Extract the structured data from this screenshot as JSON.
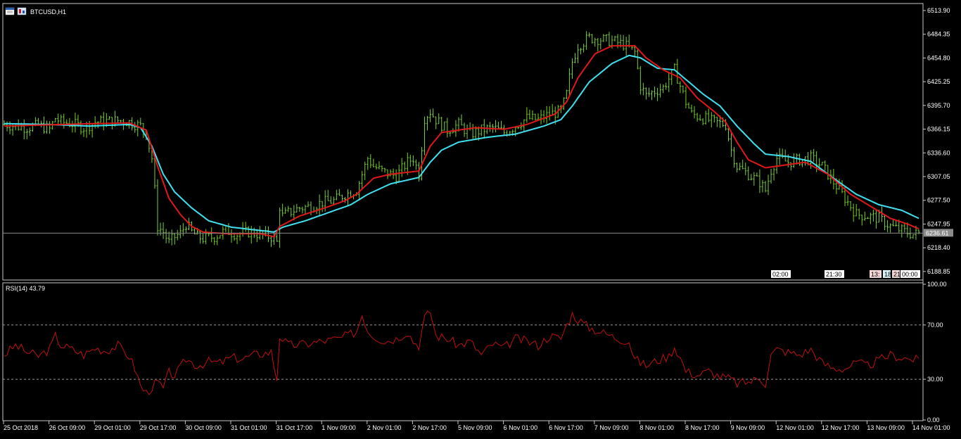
{
  "symbol_label": "BTCUSD,H1",
  "current_price_label": "6236.61",
  "time_tags": [
    "02:00",
    "21:30",
    "13:",
    "18",
    "21",
    "00:00"
  ],
  "indicator_label": "RSI(14) 43.79",
  "colors": {
    "background": "#000000",
    "candle": "#7ad12e",
    "ma_fast": "#e01818",
    "ma_slow": "#3fe0f0",
    "rsi_line": "#c01010",
    "frame": "#c8c8c8",
    "price_line": "#8a8a8a"
  },
  "icons": [
    "window-icon",
    "chart-icon"
  ],
  "chart_data": [
    {
      "type": "candlestick",
      "title": "BTCUSD,H1",
      "ylim": [
        6180,
        6520
      ],
      "y_ticks": [
        "6513.90",
        "6484.35",
        "6454.80",
        "6425.25",
        "6395.70",
        "6366.15",
        "6336.60",
        "6307.05",
        "6277.50",
        "6247.95",
        "6218.40",
        "6188.85"
      ],
      "x_ticks": [
        "25 Oct 2018",
        "26 Oct 09:00",
        "29 Oct 01:00",
        "29 Oct 17:00",
        "30 Oct 09:00",
        "31 Oct 01:00",
        "31 Oct 17:00",
        "1 Nov 09:00",
        "2 Nov 01:00",
        "2 Nov 17:00",
        "5 Nov 09:00",
        "6 Nov 01:00",
        "6 Nov 17:00",
        "7 Nov 09:00",
        "8 Nov 01:00",
        "8 Nov 17:00",
        "9 Nov 09:00",
        "12 Nov 01:00",
        "12 Nov 17:00",
        "13 Nov 09:00",
        "14 Nov 01:00"
      ],
      "current_price": 6236.61,
      "close_path": [
        [
          0,
          6372
        ],
        [
          4,
          6370
        ],
        [
          8,
          6368
        ],
        [
          12,
          6371
        ],
        [
          16,
          6366
        ],
        [
          18,
          6380
        ],
        [
          20,
          6375
        ],
        [
          24,
          6373
        ],
        [
          28,
          6368
        ],
        [
          32,
          6375
        ],
        [
          36,
          6376
        ],
        [
          40,
          6377
        ],
        [
          44,
          6375
        ],
        [
          48,
          6370
        ],
        [
          50,
          6360
        ],
        [
          52,
          6330
        ],
        [
          53,
          6290
        ],
        [
          54,
          6245
        ],
        [
          56,
          6238
        ],
        [
          58,
          6225
        ],
        [
          60,
          6232
        ],
        [
          62,
          6236
        ],
        [
          64,
          6248
        ],
        [
          66,
          6238
        ],
        [
          68,
          6232
        ],
        [
          70,
          6230
        ],
        [
          74,
          6232
        ],
        [
          78,
          6240
        ],
        [
          82,
          6235
        ],
        [
          86,
          6238
        ],
        [
          90,
          6235
        ],
        [
          94,
          6232
        ],
        [
          96,
          6225
        ],
        [
          97,
          6270
        ],
        [
          98,
          6258
        ],
        [
          100,
          6262
        ],
        [
          104,
          6268
        ],
        [
          108,
          6270
        ],
        [
          112,
          6275
        ],
        [
          116,
          6277
        ],
        [
          120,
          6285
        ],
        [
          124,
          6290
        ],
        [
          126,
          6310
        ],
        [
          128,
          6330
        ],
        [
          130,
          6320
        ],
        [
          134,
          6312
        ],
        [
          138,
          6308
        ],
        [
          142,
          6325
        ],
        [
          144,
          6330
        ],
        [
          146,
          6310
        ],
        [
          148,
          6380
        ],
        [
          150,
          6388
        ],
        [
          152,
          6378
        ],
        [
          156,
          6365
        ],
        [
          160,
          6372
        ],
        [
          164,
          6360
        ],
        [
          168,
          6365
        ],
        [
          172,
          6368
        ],
        [
          176,
          6362
        ],
        [
          180,
          6370
        ],
        [
          184,
          6380
        ],
        [
          188,
          6378
        ],
        [
          192,
          6385
        ],
        [
          196,
          6388
        ],
        [
          198,
          6410
        ],
        [
          200,
          6450
        ],
        [
          202,
          6470
        ],
        [
          206,
          6480
        ],
        [
          210,
          6478
        ],
        [
          214,
          6476
        ],
        [
          218,
          6472
        ],
        [
          222,
          6462
        ],
        [
          224,
          6420
        ],
        [
          226,
          6408
        ],
        [
          228,
          6412
        ],
        [
          232,
          6418
        ],
        [
          236,
          6440
        ],
        [
          238,
          6420
        ],
        [
          240,
          6400
        ],
        [
          242,
          6385
        ],
        [
          246,
          6380
        ],
        [
          250,
          6375
        ],
        [
          254,
          6372
        ],
        [
          256,
          6340
        ],
        [
          258,
          6320
        ],
        [
          262,
          6310
        ],
        [
          266,
          6300
        ],
        [
          268,
          6290
        ],
        [
          270,
          6315
        ],
        [
          272,
          6330
        ],
        [
          276,
          6325
        ],
        [
          280,
          6328
        ],
        [
          284,
          6330
        ],
        [
          288,
          6320
        ],
        [
          292,
          6300
        ],
        [
          296,
          6280
        ],
        [
          300,
          6260
        ],
        [
          304,
          6258
        ],
        [
          308,
          6255
        ],
        [
          312,
          6245
        ],
        [
          316,
          6240
        ],
        [
          320,
          6235
        ],
        [
          322,
          6236.61
        ]
      ],
      "ma_fast": [
        [
          0,
          6370
        ],
        [
          20,
          6372
        ],
        [
          44,
          6374
        ],
        [
          50,
          6365
        ],
        [
          54,
          6320
        ],
        [
          58,
          6280
        ],
        [
          62,
          6260
        ],
        [
          66,
          6245
        ],
        [
          70,
          6238
        ],
        [
          78,
          6236
        ],
        [
          90,
          6236
        ],
        [
          95,
          6232
        ],
        [
          97,
          6245
        ],
        [
          104,
          6258
        ],
        [
          112,
          6267
        ],
        [
          120,
          6277
        ],
        [
          124,
          6285
        ],
        [
          130,
          6305
        ],
        [
          136,
          6310
        ],
        [
          146,
          6314
        ],
        [
          150,
          6345
        ],
        [
          154,
          6362
        ],
        [
          160,
          6365
        ],
        [
          166,
          6368
        ],
        [
          176,
          6366
        ],
        [
          184,
          6372
        ],
        [
          194,
          6385
        ],
        [
          198,
          6400
        ],
        [
          202,
          6430
        ],
        [
          208,
          6460
        ],
        [
          214,
          6470
        ],
        [
          222,
          6470
        ],
        [
          226,
          6455
        ],
        [
          232,
          6440
        ],
        [
          238,
          6430
        ],
        [
          244,
          6405
        ],
        [
          250,
          6388
        ],
        [
          254,
          6375
        ],
        [
          258,
          6350
        ],
        [
          262,
          6328
        ],
        [
          268,
          6318
        ],
        [
          272,
          6320
        ],
        [
          282,
          6325
        ],
        [
          290,
          6310
        ],
        [
          298,
          6285
        ],
        [
          306,
          6268
        ],
        [
          312,
          6255
        ],
        [
          318,
          6248
        ],
        [
          322,
          6242
        ]
      ],
      "ma_slow": [
        [
          0,
          6373
        ],
        [
          16,
          6372
        ],
        [
          30,
          6370
        ],
        [
          44,
          6372
        ],
        [
          48,
          6368
        ],
        [
          52,
          6345
        ],
        [
          56,
          6310
        ],
        [
          60,
          6288
        ],
        [
          66,
          6268
        ],
        [
          72,
          6252
        ],
        [
          80,
          6244
        ],
        [
          90,
          6240
        ],
        [
          95,
          6238
        ],
        [
          98,
          6244
        ],
        [
          106,
          6252
        ],
        [
          114,
          6262
        ],
        [
          122,
          6272
        ],
        [
          128,
          6285
        ],
        [
          136,
          6298
        ],
        [
          146,
          6306
        ],
        [
          150,
          6325
        ],
        [
          154,
          6340
        ],
        [
          160,
          6350
        ],
        [
          170,
          6356
        ],
        [
          180,
          6360
        ],
        [
          190,
          6370
        ],
        [
          196,
          6378
        ],
        [
          200,
          6395
        ],
        [
          206,
          6425
        ],
        [
          214,
          6448
        ],
        [
          220,
          6458
        ],
        [
          224,
          6455
        ],
        [
          230,
          6442
        ],
        [
          236,
          6440
        ],
        [
          240,
          6428
        ],
        [
          246,
          6410
        ],
        [
          252,
          6395
        ],
        [
          258,
          6370
        ],
        [
          264,
          6348
        ],
        [
          268,
          6335
        ],
        [
          276,
          6332
        ],
        [
          284,
          6326
        ],
        [
          292,
          6305
        ],
        [
          300,
          6285
        ],
        [
          308,
          6272
        ],
        [
          316,
          6265
        ],
        [
          322,
          6255
        ]
      ]
    },
    {
      "type": "line",
      "title": "RSI(14) 43.79",
      "series": [
        {
          "name": "RSI(14)",
          "values": []
        }
      ],
      "ylim": [
        0,
        100
      ],
      "y_ticks": [
        "100.00",
        "70.00",
        "30.00",
        "0.00"
      ],
      "levels": [
        70,
        30
      ],
      "last_value": 43.79,
      "rsi_path": [
        [
          0,
          48
        ],
        [
          4,
          55
        ],
        [
          8,
          50
        ],
        [
          12,
          47
        ],
        [
          16,
          52
        ],
        [
          18,
          62
        ],
        [
          20,
          55
        ],
        [
          24,
          52
        ],
        [
          28,
          48
        ],
        [
          32,
          53
        ],
        [
          36,
          51
        ],
        [
          40,
          55
        ],
        [
          44,
          47
        ],
        [
          46,
          38
        ],
        [
          48,
          25
        ],
        [
          50,
          20
        ],
        [
          52,
          24
        ],
        [
          54,
          28
        ],
        [
          56,
          23
        ],
        [
          58,
          35
        ],
        [
          60,
          33
        ],
        [
          62,
          38
        ],
        [
          64,
          45
        ],
        [
          68,
          40
        ],
        [
          72,
          43
        ],
        [
          76,
          42
        ],
        [
          80,
          46
        ],
        [
          84,
          45
        ],
        [
          88,
          48
        ],
        [
          94,
          50
        ],
        [
          96,
          30
        ],
        [
          97,
          62
        ],
        [
          100,
          55
        ],
        [
          106,
          56
        ],
        [
          112,
          58
        ],
        [
          118,
          60
        ],
        [
          124,
          65
        ],
        [
          126,
          78
        ],
        [
          128,
          66
        ],
        [
          130,
          62
        ],
        [
          134,
          58
        ],
        [
          138,
          60
        ],
        [
          142,
          65
        ],
        [
          144,
          58
        ],
        [
          146,
          55
        ],
        [
          148,
          75
        ],
        [
          150,
          80
        ],
        [
          152,
          62
        ],
        [
          156,
          60
        ],
        [
          160,
          55
        ],
        [
          164,
          58
        ],
        [
          168,
          48
        ],
        [
          172,
          56
        ],
        [
          176,
          53
        ],
        [
          180,
          60
        ],
        [
          184,
          58
        ],
        [
          188,
          55
        ],
        [
          192,
          62
        ],
        [
          196,
          60
        ],
        [
          198,
          70
        ],
        [
          200,
          78
        ],
        [
          202,
          74
        ],
        [
          206,
          68
        ],
        [
          210,
          65
        ],
        [
          216,
          60
        ],
        [
          220,
          58
        ],
        [
          222,
          45
        ],
        [
          226,
          40
        ],
        [
          230,
          44
        ],
        [
          234,
          47
        ],
        [
          236,
          54
        ],
        [
          238,
          46
        ],
        [
          240,
          36
        ],
        [
          244,
          33
        ],
        [
          248,
          36
        ],
        [
          252,
          32
        ],
        [
          256,
          30
        ],
        [
          258,
          27
        ],
        [
          262,
          28
        ],
        [
          266,
          31
        ],
        [
          268,
          27
        ],
        [
          270,
          48
        ],
        [
          272,
          52
        ],
        [
          276,
          50
        ],
        [
          280,
          48
        ],
        [
          284,
          52
        ],
        [
          288,
          42
        ],
        [
          292,
          38
        ],
        [
          296,
          38
        ],
        [
          300,
          42
        ],
        [
          304,
          40
        ],
        [
          308,
          44
        ],
        [
          312,
          48
        ],
        [
          316,
          46
        ],
        [
          322,
          44
        ]
      ]
    }
  ]
}
